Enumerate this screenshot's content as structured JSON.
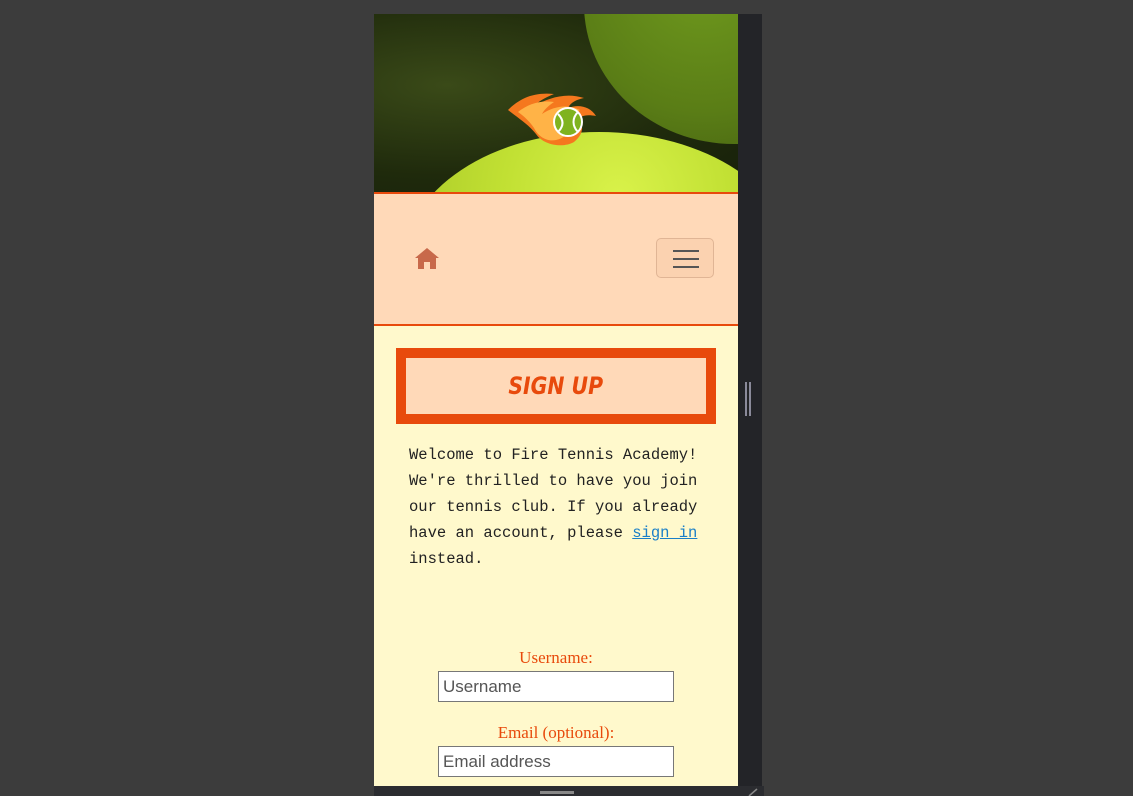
{
  "header": {
    "logo_icon": "flaming-tennis-ball-logo"
  },
  "navbar": {
    "home_icon": "home-icon",
    "menu_icon": "hamburger-menu-icon"
  },
  "main": {
    "title": "SIGN UP",
    "intro_before_link": "Welcome to Fire Tennis Academy! We're thrilled to have you join our tennis club. If you already have an account, please ",
    "intro_link": "sign in",
    "intro_after_link": " instead.",
    "form": {
      "username_label": "Username:",
      "username_placeholder": "Username",
      "email_label": "Email (optional):",
      "email_placeholder": "Email address"
    }
  },
  "colors": {
    "accent": "#e84a0c",
    "navbar_bg": "#ffd9b8",
    "page_bg": "#fff9cc",
    "link": "#1a7fc8"
  }
}
